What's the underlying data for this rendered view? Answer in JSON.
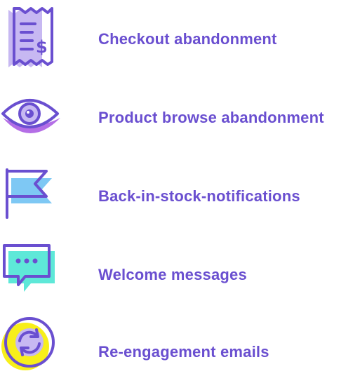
{
  "colors": {
    "brand_purple": "#6a4fd0",
    "icon_purple": "#7a5cd6",
    "lavender": "#c7b8f2",
    "mint": "#5ee8d8",
    "sky": "#7ec8f4",
    "yellow": "#f7ef1a",
    "orchid": "#b46ee6"
  },
  "features": [
    {
      "label": "Checkout abandonment",
      "icon": "receipt-icon"
    },
    {
      "label": "Product browse abandonment",
      "icon": "eye-icon"
    },
    {
      "label": "Back-in-stock-notifications",
      "icon": "flag-icon"
    },
    {
      "label": "Welcome messages",
      "icon": "chat-bubble-icon"
    },
    {
      "label": "Re-engagement emails",
      "icon": "refresh-cycle-icon"
    }
  ]
}
